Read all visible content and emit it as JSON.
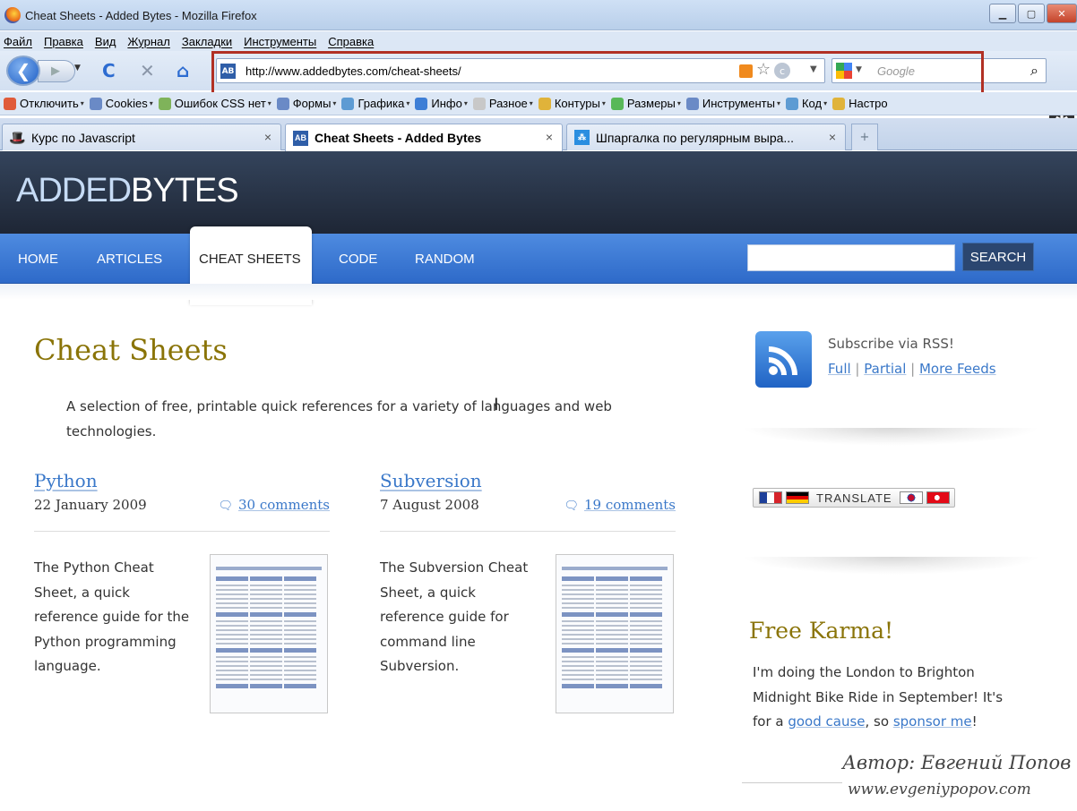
{
  "window": {
    "title": "Cheat Sheets - Added Bytes - Mozilla Firefox"
  },
  "menu": [
    "Файл",
    "Правка",
    "Вид",
    "Журнал",
    "Закладки",
    "Инструменты",
    "Справка"
  ],
  "navigation": {
    "url": "http://www.addedbytes.com/cheat-sheets/",
    "favicon_text": "AB",
    "search_placeholder": "Google"
  },
  "bookmarks": [
    {
      "label": "Отключить",
      "color": "#e05b3a"
    },
    {
      "label": "Cookies",
      "color": "#6a8ac6"
    },
    {
      "label": "Ошибок CSS нет",
      "color": "#7fb35a"
    },
    {
      "label": "Формы",
      "color": "#6a8ac6"
    },
    {
      "label": "Графика",
      "color": "#5d9bd3"
    },
    {
      "label": "Инфо",
      "color": "#3d7ed6"
    },
    {
      "label": "Разное",
      "color": "#c8c8c8"
    },
    {
      "label": "Контуры",
      "color": "#e0b33a"
    },
    {
      "label": "Размеры",
      "color": "#58b858"
    },
    {
      "label": "Инструменты",
      "color": "#6a8ac6"
    },
    {
      "label": "Код",
      "color": "#5d9bd3"
    },
    {
      "label": "Настро",
      "color": "#e0b33a"
    }
  ],
  "tabs": [
    {
      "label": "Курс по Javascript",
      "icon_text": "",
      "active": false
    },
    {
      "label": "Cheat Sheets - Added Bytes",
      "icon_text": "AB",
      "active": true
    },
    {
      "label": "Шпаргалка по регулярным выра...",
      "icon_text": "",
      "active": false
    }
  ],
  "site": {
    "logo_added": "ADDED",
    "logo_bytes": "BYTES",
    "nav": [
      "HOME",
      "ARTICLES",
      "CHEAT SHEETS",
      "CODE",
      "RANDOM"
    ],
    "search_button": "SEARCH"
  },
  "page": {
    "title": "Cheat Sheets",
    "intro_1": "A selection of free, printable quick references for a variety of languages and web",
    "intro_2": "technologies."
  },
  "articles": [
    {
      "title": "Python",
      "date": "22 January 2009",
      "comments": "30 comments",
      "text_lines": [
        "The Python Cheat",
        "Sheet, a quick",
        "reference guide for the",
        "Python programming",
        "language."
      ]
    },
    {
      "title": "Subversion",
      "date": "7 August 2008",
      "comments": "19 comments",
      "text_lines": [
        "The Subversion Cheat",
        "Sheet, a quick",
        "reference guide for",
        "command line",
        "Subversion."
      ]
    }
  ],
  "sidebar": {
    "rss_label": "Subscribe via RSS!",
    "rss_full": "Full",
    "rss_partial": "Partial",
    "rss_more": "More Feeds",
    "translate": "TRANSLATE",
    "karma_title": "Free Karma!",
    "karma_1": "I'm doing the London to Brighton",
    "karma_2": "Midnight Bike Ride in September! It's",
    "karma_3a": "for a ",
    "karma_link1": "good cause",
    "karma_3b": ", so ",
    "karma_link2": "sponsor me",
    "karma_3c": "!"
  },
  "watermark": {
    "author": "Автор: Евгений Попов",
    "url": "www.evgeniypopov.com"
  },
  "colors": {
    "accent_gold": "#8a7408",
    "link_blue": "#3a78c9",
    "nav_blue": "#2e6ac9",
    "header_dark": "#1e2635",
    "highlight_red": "#b13024"
  }
}
